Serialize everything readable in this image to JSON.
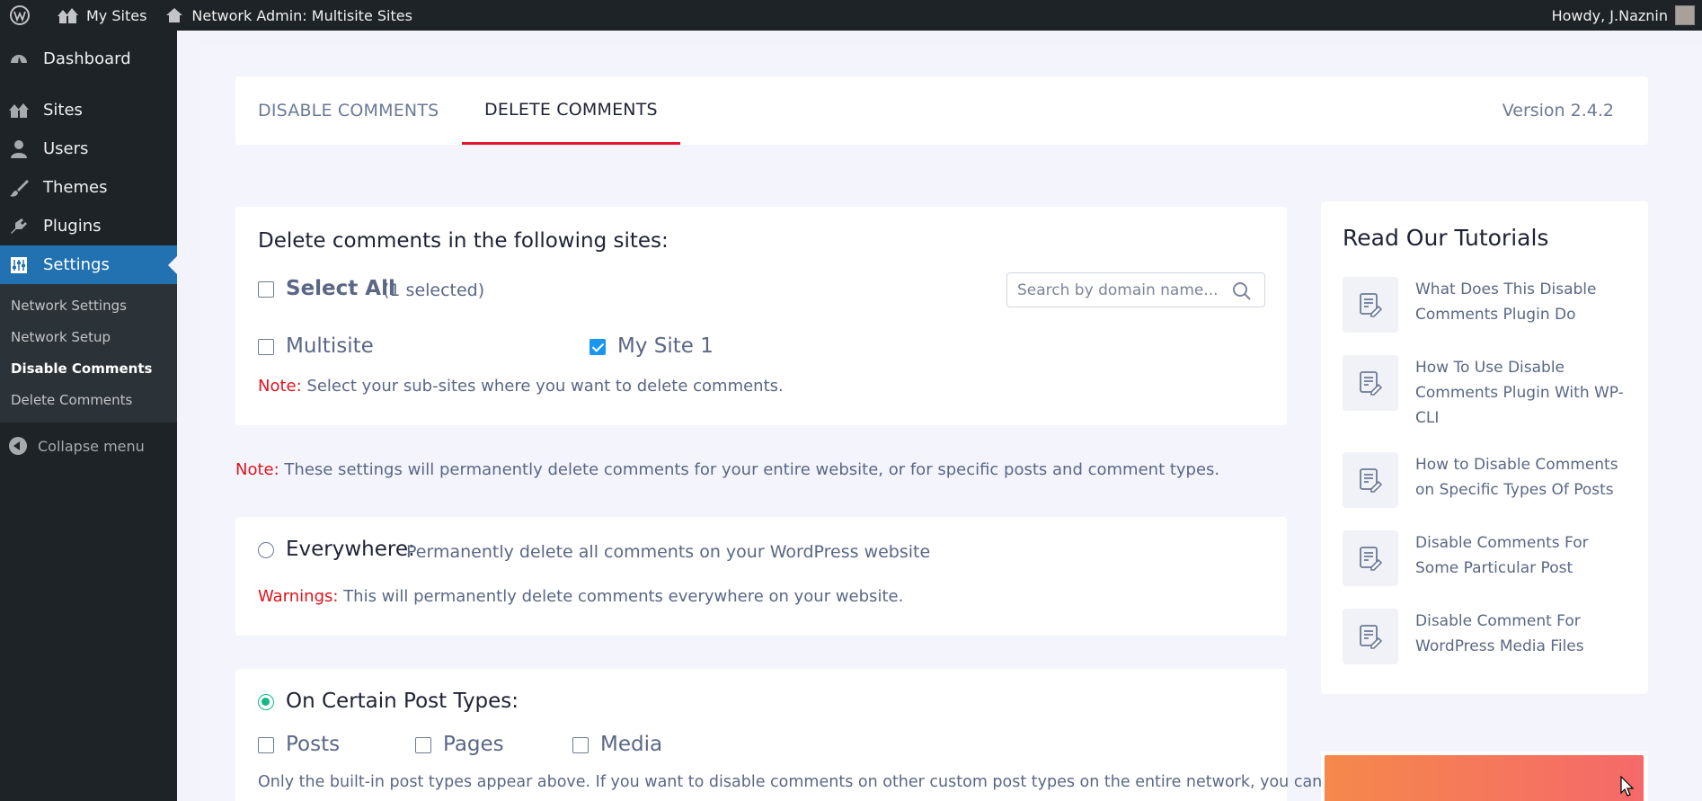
{
  "adminbar": {
    "my_sites": "My Sites",
    "network_admin": "Network Admin: Multisite Sites",
    "howdy": "Howdy, J.Naznin"
  },
  "sidebar": {
    "items": [
      {
        "label": "Dashboard",
        "icon": "dashboard-icon"
      },
      {
        "label": "Sites",
        "icon": "sites-icon"
      },
      {
        "label": "Users",
        "icon": "users-icon"
      },
      {
        "label": "Themes",
        "icon": "themes-icon"
      },
      {
        "label": "Plugins",
        "icon": "plugins-icon"
      },
      {
        "label": "Settings",
        "icon": "settings-icon"
      }
    ],
    "submenu": [
      "Network Settings",
      "Network Setup",
      "Disable Comments",
      "Delete Comments"
    ],
    "collapse": "Collapse menu"
  },
  "tabs": {
    "disable": "DISABLE COMMENTS",
    "delete": "DELETE COMMENTS",
    "version": "Version 2.4.2"
  },
  "sites": {
    "title": "Delete comments in the following sites:",
    "select_all": "Select All",
    "selected_count": "(1 selected)",
    "search_placeholder": "Search by domain name...",
    "site_1": "Multisite",
    "site_2": "My Site 1",
    "note_label": "Note:",
    "note_text": " Select your sub-sites where you want to delete comments."
  },
  "general_note": {
    "label": "Note:",
    "text": " These settings will permanently delete comments for your entire website, or for specific posts and comment types."
  },
  "everywhere": {
    "title": "Everywhere:",
    "desc": " Permanently delete all comments on your WordPress website",
    "warn_label": "Warnings:",
    "warn_text": " This will permanently delete comments everywhere on your website."
  },
  "post_types": {
    "title": "On Certain Post Types:",
    "posts": "Posts",
    "pages": "Pages",
    "media": "Media",
    "help": "Only the built-in post types appear above. If you want to disable comments on other custom post types on the entire network, you can"
  },
  "tutorials": {
    "title": "Read Our Tutorials",
    "items": [
      "What Does This Disable Comments Plugin Do",
      "How To Use Disable Comments Plugin With WP-CLI",
      "How to Disable Comments on Specific Types Of Posts",
      "Disable Comments For Some Particular Post",
      "Disable Comment For WordPress Media Files"
    ]
  },
  "colors": {
    "accent_red": "#e0141e",
    "wp_blue": "#2271b1",
    "check_blue": "#1a96f0",
    "radio_green": "#12b886"
  }
}
